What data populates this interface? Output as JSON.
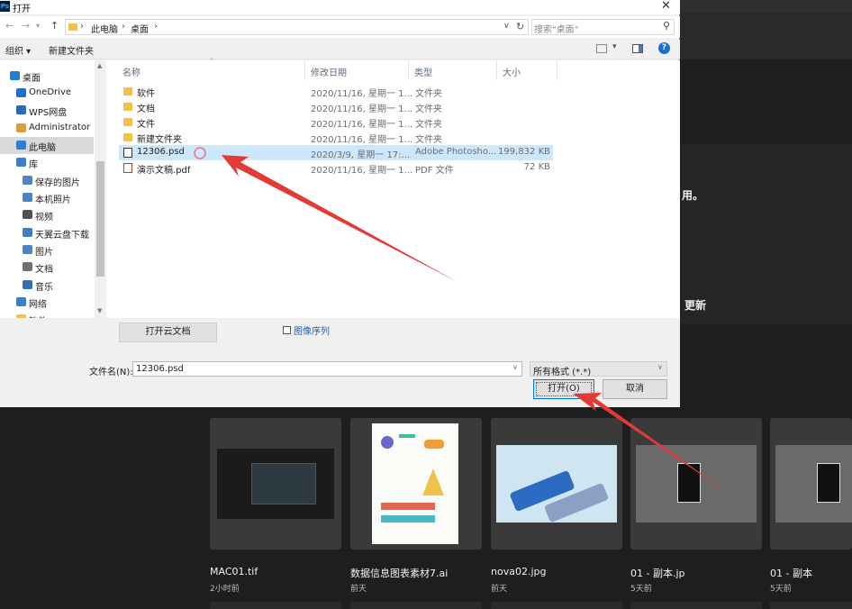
{
  "window": {
    "title": "打开",
    "app_icon": "Ps"
  },
  "address": {
    "crumbs": [
      "此电脑",
      "桌面"
    ],
    "search_placeholder": "搜索\"桌面\""
  },
  "toolbar": {
    "organize": "组织 ▾",
    "new_folder": "新建文件夹"
  },
  "nav": {
    "items": [
      {
        "label": "桌面",
        "icon": "desktop-icon",
        "color": "#1f7dd6"
      },
      {
        "label": "OneDrive",
        "icon": "cloud-icon",
        "color": "#1f6fc5"
      },
      {
        "label": "WPS网盘",
        "icon": "cloud-icon",
        "color": "#2a6ab8"
      },
      {
        "label": "Administrator",
        "icon": "user-icon",
        "color": "#d8a03a"
      },
      {
        "label": "此电脑",
        "icon": "computer-icon",
        "color": "#2f80d0"
      },
      {
        "label": "库",
        "icon": "library-icon",
        "color": "#3c7fc8"
      },
      {
        "label": "保存的图片",
        "icon": "pictures-icon",
        "color": "#4a86c5"
      },
      {
        "label": "本机照片",
        "icon": "pictures-icon",
        "color": "#4a86c5"
      },
      {
        "label": "视频",
        "icon": "video-icon",
        "color": "#505050"
      },
      {
        "label": "天翼云盘下载",
        "icon": "download-icon",
        "color": "#3c7fc8"
      },
      {
        "label": "图片",
        "icon": "pictures-icon",
        "color": "#4a86c5"
      },
      {
        "label": "文档",
        "icon": "documents-icon",
        "color": "#707070"
      },
      {
        "label": "音乐",
        "icon": "music-icon",
        "color": "#2f6fb8"
      },
      {
        "label": "网络",
        "icon": "network-icon",
        "color": "#3c7fc8"
      },
      {
        "label": "软件",
        "icon": "folder-icon",
        "color": "#f3c14b"
      }
    ]
  },
  "columns": {
    "name": "名称",
    "date": "修改日期",
    "type": "类型",
    "size": "大小"
  },
  "files": [
    {
      "name": "软件",
      "date": "2020/11/16, 星期一 1...",
      "type": "文件夹",
      "size": "",
      "icon": "folder"
    },
    {
      "name": "文档",
      "date": "2020/11/16, 星期一 1...",
      "type": "文件夹",
      "size": "",
      "icon": "folder"
    },
    {
      "name": "文件",
      "date": "2020/11/16, 星期一 1...",
      "type": "文件夹",
      "size": "",
      "icon": "folder"
    },
    {
      "name": "新建文件夹",
      "date": "2020/11/16, 星期一 1...",
      "type": "文件夹",
      "size": "",
      "icon": "folder"
    },
    {
      "name": "12306.psd",
      "date": "2020/3/9, 星期一 17:...",
      "type": "Adobe Photosho...",
      "size": "199,832 KB",
      "icon": "psd"
    },
    {
      "name": "演示文稿.pdf",
      "date": "2020/11/16, 星期一 1...",
      "type": "PDF 文件",
      "size": "72 KB",
      "icon": "pdf"
    }
  ],
  "bottom": {
    "cloud_button": "打开云文档",
    "image_sequence": "图像序列",
    "filename_label": "文件名(N):",
    "filename_value": "12306.psd",
    "filetype": "所有格式 (*.*)",
    "open_button": "打开(O)",
    "cancel_button": "取消"
  },
  "background": {
    "text1": "用。",
    "text2": "更新",
    "thumbs": [
      {
        "name": "MAC01.tif",
        "time": "2小时前"
      },
      {
        "name": "数据信息图表素材7.ai",
        "time": "前天"
      },
      {
        "name": "nova02.jpg",
        "time": "前天"
      },
      {
        "name": "01 - 副本.jp",
        "time": "5天前"
      },
      {
        "name": "01 - 副本",
        "time": "5天前"
      }
    ]
  },
  "colors": {
    "selection": "#cce8ff",
    "arrow": "#e53935",
    "dialog_bg": "#f0f0f0"
  }
}
